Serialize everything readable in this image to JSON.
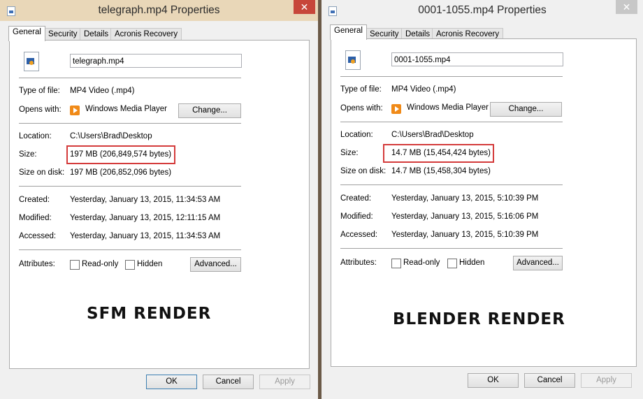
{
  "windows": [
    {
      "title": "telegraph.mp4 Properties",
      "close": "✕",
      "tabs": [
        "General",
        "Security",
        "Details",
        "Acronis Recovery"
      ],
      "file_name": "telegraph.mp4",
      "type_label": "Type of file:",
      "type_value": "MP4 Video (.mp4)",
      "opens_label": "Opens with:",
      "opens_value": "Windows Media Player",
      "change_label": "Change...",
      "location_label": "Location:",
      "location_value": "C:\\Users\\Brad\\Desktop",
      "size_label": "Size:",
      "size_value": "197 MB (206,849,574 bytes)",
      "size_disk_label": "Size on disk:",
      "size_disk_value": "197 MB (206,852,096 bytes)",
      "created_label": "Created:",
      "created_value": "Yesterday, January 13, 2015, 11:34:53 AM",
      "modified_label": "Modified:",
      "modified_value": "Yesterday, January 13, 2015, 12:11:15 AM",
      "accessed_label": "Accessed:",
      "accessed_value": "Yesterday, January 13, 2015, 11:34:53 AM",
      "attributes_label": "Attributes:",
      "readonly_label": "Read-only",
      "hidden_label": "Hidden",
      "advanced_label": "Advanced...",
      "caption": "SFM RENDER",
      "ok_label": "OK",
      "cancel_label": "Cancel",
      "apply_label": "Apply"
    },
    {
      "title": "0001-1055.mp4 Properties",
      "close": "✕",
      "tabs": [
        "General",
        "Security",
        "Details",
        "Acronis Recovery"
      ],
      "file_name": "0001-1055.mp4",
      "type_label": "Type of file:",
      "type_value": "MP4 Video (.mp4)",
      "opens_label": "Opens with:",
      "opens_value": "Windows Media Player",
      "change_label": "Change...",
      "location_label": "Location:",
      "location_value": "C:\\Users\\Brad\\Desktop",
      "size_label": "Size:",
      "size_value": "14.7 MB (15,454,424 bytes)",
      "size_disk_label": "Size on disk:",
      "size_disk_value": "14.7 MB (15,458,304 bytes)",
      "created_label": "Created:",
      "created_value": "Yesterday, January 13, 2015, 5:10:39 PM",
      "modified_label": "Modified:",
      "modified_value": "Yesterday, January 13, 2015, 5:16:06 PM",
      "accessed_label": "Accessed:",
      "accessed_value": "Yesterday, January 13, 2015, 5:10:39 PM",
      "attributes_label": "Attributes:",
      "readonly_label": "Read-only",
      "hidden_label": "Hidden",
      "advanced_label": "Advanced...",
      "caption": "BLENDER RENDER",
      "ok_label": "OK",
      "cancel_label": "Cancel",
      "apply_label": "Apply"
    }
  ],
  "colors": {
    "highlight": "#d43b3b",
    "close_active": "#c7463a"
  },
  "icons": {
    "file": "mp4-file-icon",
    "player": "windows-media-player-icon",
    "close": "close-icon"
  }
}
